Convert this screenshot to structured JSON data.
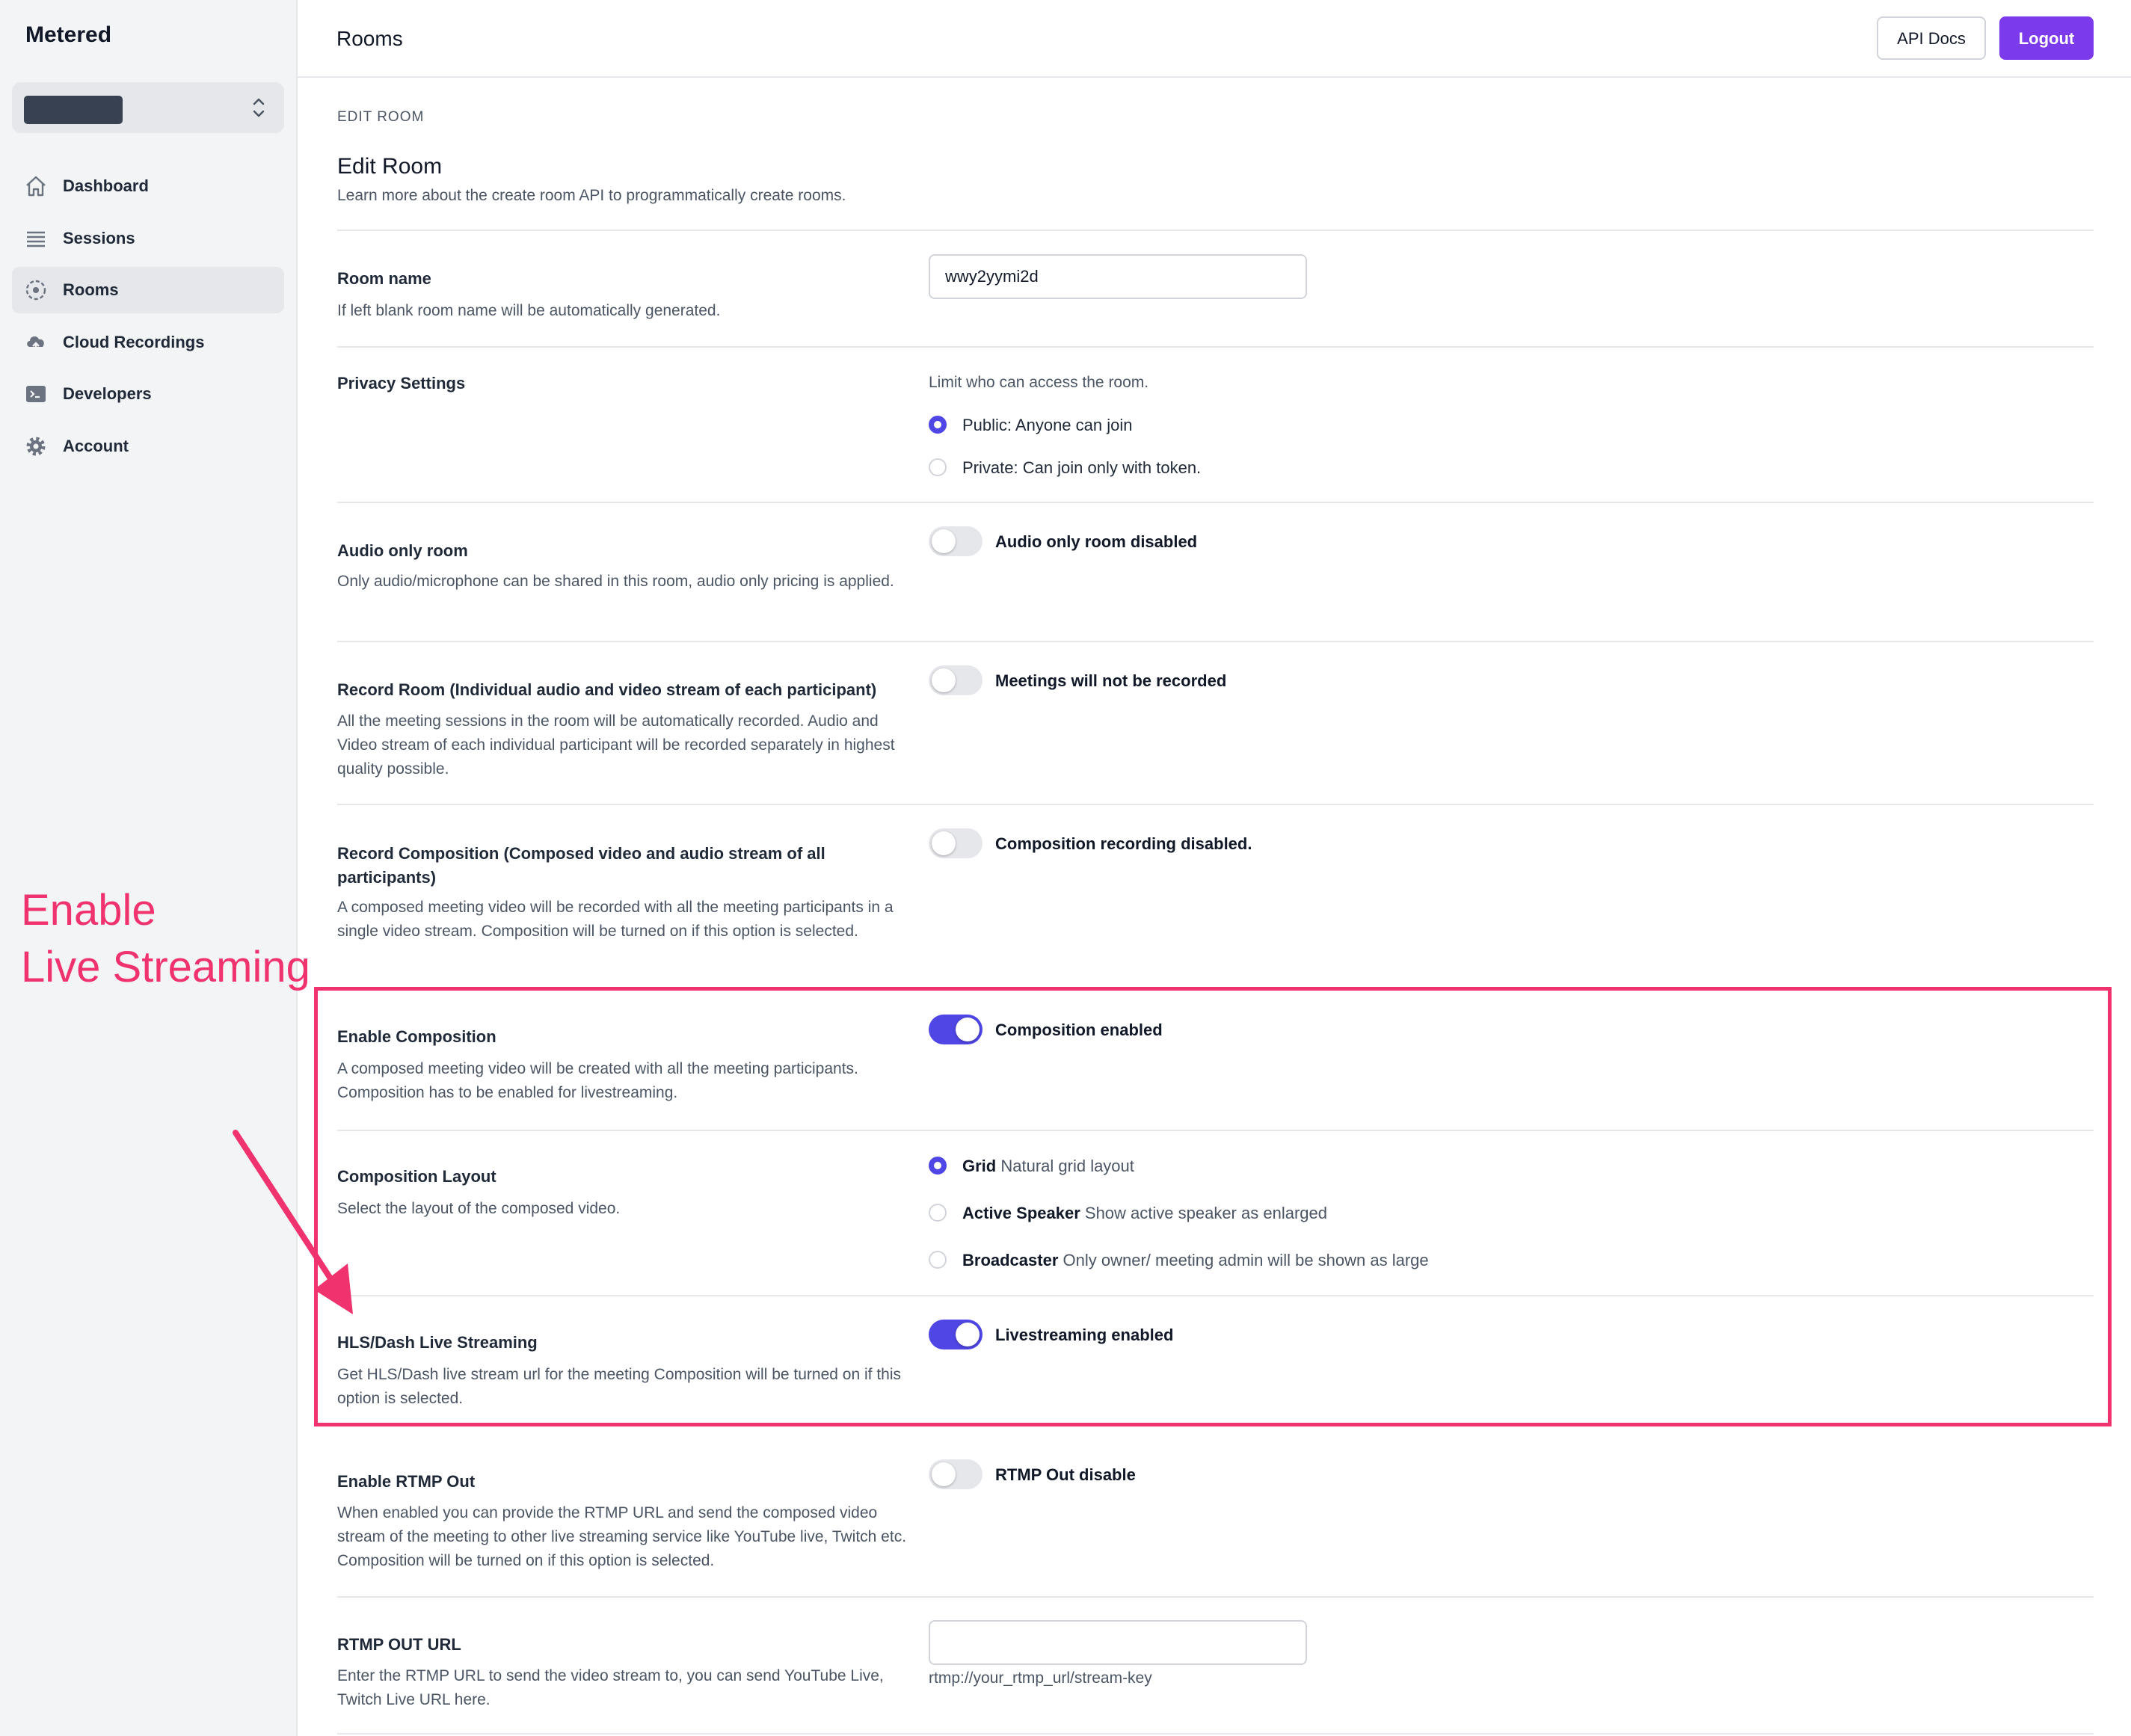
{
  "sidebar": {
    "brand": "Metered",
    "items": [
      {
        "label": "Dashboard",
        "icon": "home-icon"
      },
      {
        "label": "Sessions",
        "icon": "list-icon"
      },
      {
        "label": "Rooms",
        "icon": "rooms-icon",
        "active": true
      },
      {
        "label": "Cloud Recordings",
        "icon": "cloud-upload-icon"
      },
      {
        "label": "Developers",
        "icon": "terminal-icon"
      },
      {
        "label": "Account",
        "icon": "gear-icon"
      }
    ]
  },
  "header": {
    "title": "Rooms",
    "api_docs_label": "API Docs",
    "logout_label": "Logout"
  },
  "page": {
    "section_label": "EDIT ROOM",
    "heading": "Edit Room",
    "subheading": "Learn more about the create room API to programmatically create rooms."
  },
  "form": {
    "room_name": {
      "label": "Room name",
      "desc": "If left blank room name will be automatically generated.",
      "value": "wwy2yymi2d"
    },
    "privacy": {
      "label": "Privacy Settings",
      "hint": "Limit who can access the room.",
      "options": [
        {
          "label": "Public: Anyone can join",
          "selected": true
        },
        {
          "label": "Private: Can join only with token.",
          "selected": false
        }
      ]
    },
    "audio_only": {
      "label": "Audio only room",
      "desc": "Only audio/microphone can be shared in this room, audio only pricing is applied.",
      "toggle_label": "Audio only room disabled",
      "enabled": false
    },
    "record_room": {
      "label": "Record Room (Individual audio and video stream of each participant)",
      "desc": "All the meeting sessions in the room will be automatically recorded. Audio and Video stream of each individual participant will be recorded separately in highest quality possible.",
      "toggle_label": "Meetings will not be recorded",
      "enabled": false
    },
    "record_composition": {
      "label": "Record Composition (Composed video and audio stream of all participants)",
      "desc": "A composed meeting video will be recorded with all the meeting participants in a single video stream. Composition will be turned on if this option is selected.",
      "toggle_label": "Composition recording disabled.",
      "enabled": false
    },
    "enable_composition": {
      "label": "Enable Composition",
      "desc": "A composed meeting video will be created with all the meeting participants. Composition has to be enabled for livestreaming.",
      "toggle_label": "Composition enabled",
      "enabled": true
    },
    "composition_layout": {
      "label": "Composition Layout",
      "desc": "Select the layout of the composed video.",
      "options": [
        {
          "name": "Grid",
          "hint": "Natural grid layout",
          "selected": true
        },
        {
          "name": "Active Speaker",
          "hint": "Show active speaker as enlarged",
          "selected": false
        },
        {
          "name": "Broadcaster",
          "hint": "Only owner/ meeting admin will be shown as large",
          "selected": false
        }
      ]
    },
    "hls_streaming": {
      "label": "HLS/Dash Live Streaming",
      "desc": "Get HLS/Dash live stream url for the meeting Composition will be turned on if this option is selected.",
      "toggle_label": "Livestreaming enabled",
      "enabled": true
    },
    "rtmp_out": {
      "label": "Enable RTMP Out",
      "desc": "When enabled you can provide the RTMP URL and send the composed video stream of the meeting to other live streaming service like YouTube live, Twitch etc. Composition will be turned on if this option is selected.",
      "toggle_label": "RTMP Out disable",
      "enabled": false
    },
    "rtmp_url": {
      "label": "RTMP OUT URL",
      "desc": "Enter the RTMP URL to send the video stream to, you can send YouTube Live, Twitch Live URL here.",
      "value": "",
      "hint": "rtmp://your_rtmp_url/stream-key"
    }
  },
  "annotation": {
    "line1": "Enable",
    "line2": "Live Streaming",
    "color": "#f0326e"
  },
  "colors": {
    "accent": "#4f46e5",
    "logout": "#7c3aed"
  }
}
